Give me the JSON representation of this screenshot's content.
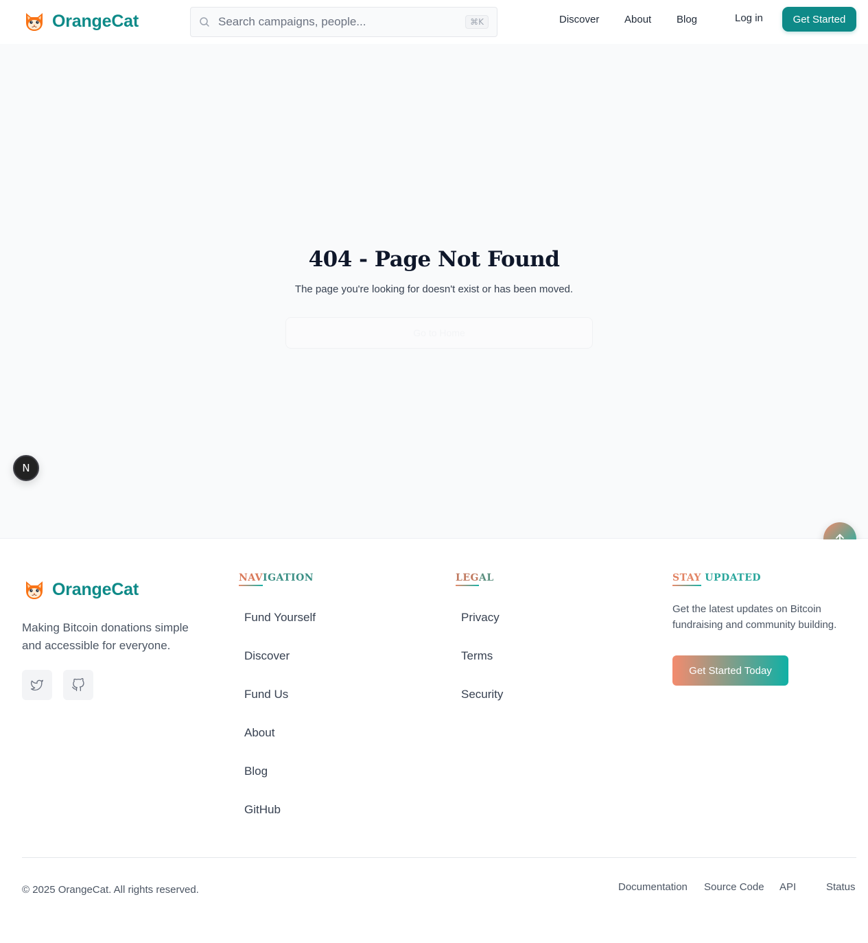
{
  "header": {
    "brand": "OrangeCat",
    "search_placeholder": "Search campaigns, people...",
    "search_shortcut": "⌘K",
    "nav": [
      "Discover",
      "About",
      "Blog"
    ],
    "login": "Log in",
    "cta": "Get Started"
  },
  "main": {
    "title": "404 - Page Not Found",
    "subtitle": "The page you're looking for doesn't exist or has been moved.",
    "home_button": "Go to Home",
    "badge": "N"
  },
  "footer": {
    "brand": "OrangeCat",
    "tagline": "Making Bitcoin donations simple and accessible for everyone.",
    "navigation": {
      "heading_hl": "NAV",
      "heading_rest": "IGATION",
      "links": [
        "Fund Yourself",
        "Discover",
        "Fund Us",
        "About",
        "Blog",
        "GitHub"
      ]
    },
    "legal": {
      "heading_hl": "LEG",
      "heading_rest": "AL",
      "links": [
        "Privacy",
        "Terms",
        "Security"
      ]
    },
    "stay_updated": {
      "heading_hl": "STAY",
      "heading_rest": " UPDATED",
      "text": "Get the latest updates on Bitcoin fundraising and community building.",
      "button": "Get Started Today"
    },
    "copyright": "© 2025 OrangeCat. All rights reserved.",
    "bottom_links": [
      "Documentation",
      "Source Code",
      "API",
      "Status"
    ]
  },
  "colors": {
    "brand_teal": "#0e8a88",
    "accent_orange": "#f08a6a",
    "page_bg": "#f9fafb"
  },
  "icons": [
    "cat-logo-icon",
    "search-icon",
    "arrow-up-icon",
    "twitter-icon",
    "github-icon"
  ]
}
